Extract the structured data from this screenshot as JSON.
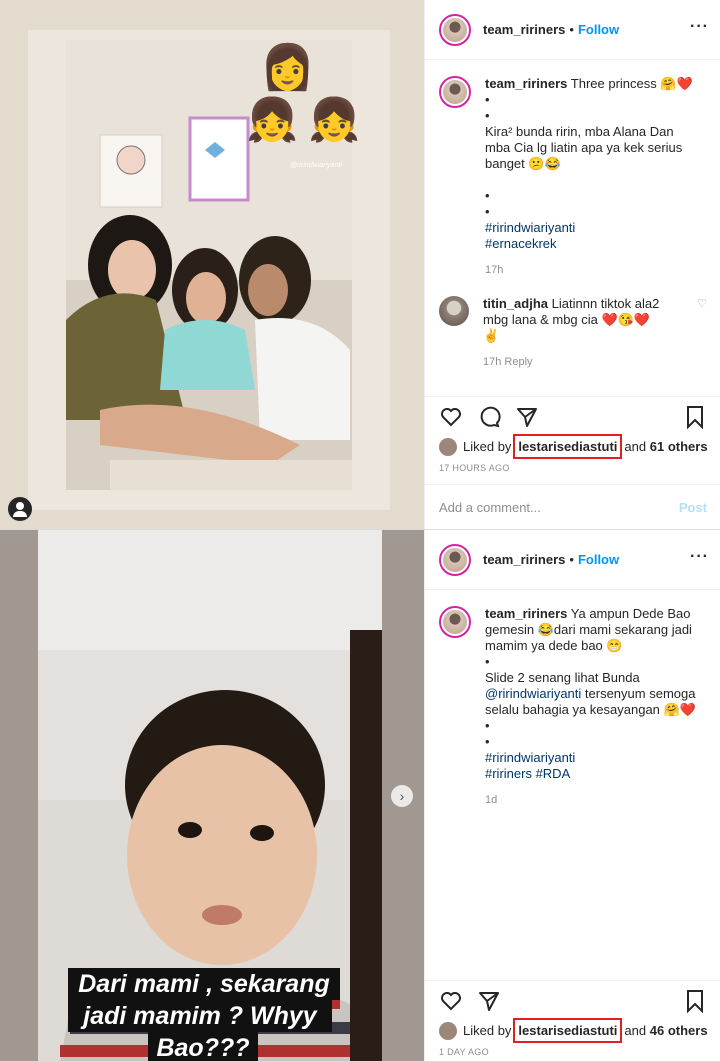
{
  "post1": {
    "username": "team_ririners",
    "follow_label": "Follow",
    "caption": {
      "user": "team_ririners",
      "lines": [
        "Three princess 🤗❤️",
        "•",
        "•",
        "Kira² bunda ririn, mba Alana Dan",
        "mba Cia lg liatin apa ya kek serius",
        "banget 😕😂",
        "",
        "•",
        "•"
      ],
      "tags": [
        "#ririndwiariyanti",
        "#ernacekrek"
      ],
      "time": "17h"
    },
    "comment": {
      "user": "titin_adjha",
      "lines": [
        "Liatinnn tiktok ala2",
        "mbg lana & mbg cia ❤️😘❤️",
        "✌️"
      ],
      "meta": "17h   Reply"
    },
    "likes": {
      "prefix": "Liked by",
      "user": "lestarisediastuti",
      "suffix": "and",
      "others": "61 others"
    },
    "ago": "17 HOURS AGO",
    "add_comment_placeholder": "Add a comment...",
    "post_label": "Post",
    "image": {
      "watermark": "@ririndwiariyanti"
    }
  },
  "post2": {
    "username": "team_ririners",
    "follow_label": "Follow",
    "caption": {
      "user": "team_ririners",
      "lines": [
        "Ya ampun Dede Bao",
        "gemesin 😂dari mami sekarang jadi",
        "mamim ya dede bao 😁",
        "•",
        "Slide 2 senang lihat Bunda"
      ],
      "mention": "@ririndwiariyanti",
      "lines2": [
        "selalu bahagia ya kesayangan 🤗❤️",
        "•",
        "•"
      ],
      "mention_after": "tersenyum semoga",
      "tags": [
        "#ririndwiariyanti",
        "#ririners #RDA"
      ],
      "time": "1d"
    },
    "likes": {
      "prefix": "Liked by",
      "user": "lestarisediastuti",
      "suffix": "and",
      "others": "46 others"
    },
    "ago": "1 DAY AGO",
    "image": {
      "subtitle_line1": "Dari mami , sekarang",
      "subtitle_line2": "jadi mamim ? Whyy",
      "subtitle_line3": "Bao???"
    }
  },
  "colors": {
    "accent": "#0095f6",
    "highlight": "#e02020"
  }
}
